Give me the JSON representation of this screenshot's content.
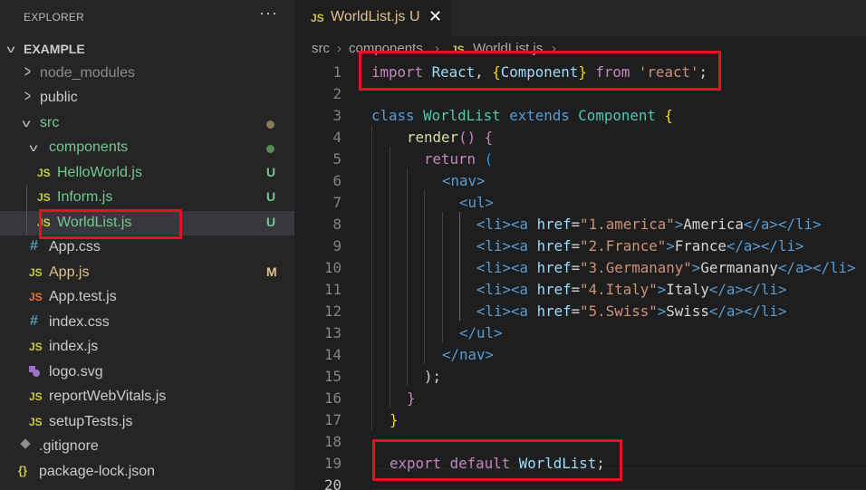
{
  "explorer": {
    "title": "EXPLORER",
    "more": "···",
    "section": "EXAMPLE",
    "items": [
      {
        "label": "node_modules",
        "status": ""
      },
      {
        "label": "public",
        "status": ""
      },
      {
        "label": "src",
        "status": ""
      },
      {
        "label": "components",
        "status": ""
      },
      {
        "label": "HelloWorld.js",
        "status": "U"
      },
      {
        "label": "Inform.js",
        "status": "U"
      },
      {
        "label": "WorldList.js",
        "status": "U"
      },
      {
        "label": "App.css",
        "status": ""
      },
      {
        "label": "App.js",
        "status": "M"
      },
      {
        "label": "App.test.js",
        "status": ""
      },
      {
        "label": "index.css",
        "status": ""
      },
      {
        "label": "index.js",
        "status": ""
      },
      {
        "label": "logo.svg",
        "status": ""
      },
      {
        "label": "reportWebVitals.js",
        "status": ""
      },
      {
        "label": "setupTests.js",
        "status": ""
      },
      {
        "label": ".gitignore",
        "status": ""
      },
      {
        "label": "package-lock.json",
        "status": ""
      }
    ],
    "icons": {
      "js": "JS",
      "css": "#",
      "svg": "svg-icon",
      "git": "gitignore-icon",
      "json": "{}"
    }
  },
  "tab": {
    "icon": "JS",
    "label": "WorldList.js",
    "status": "U",
    "close": "✕"
  },
  "breadcrumb": {
    "src": "src",
    "sep": "›",
    "components": "components",
    "file_icon": "JS",
    "file": "WorldList.js"
  },
  "code": {
    "line_numbers": [
      "1",
      "2",
      "3",
      "4",
      "5",
      "6",
      "7",
      "8",
      "9",
      "10",
      "11",
      "12",
      "13",
      "14",
      "15",
      "16",
      "17",
      "18",
      "19",
      "20"
    ],
    "l1": {
      "import": "import",
      "react": "React",
      "comma": ", ",
      "lb": "{",
      "component": "Component",
      "rb": "}",
      "from": "from",
      "module": "'react'",
      "semi": ";"
    },
    "l3": {
      "class": "class",
      "name": "WorldList",
      "extends": "extends",
      "base": "Component",
      "brace": "{"
    },
    "l4": {
      "render": "render",
      "paren": "()",
      "brace": "{"
    },
    "l5": {
      "return": "return",
      "paren": "("
    },
    "l6": "<nav>",
    "l7": "<ul>",
    "items": [
      {
        "href": "\"1.america\"",
        "text": "America"
      },
      {
        "href": "\"2.France\"",
        "text": "France"
      },
      {
        "href": "\"3.Germanany\"",
        "text": "Germanany"
      },
      {
        "href": "\"4.Italy\"",
        "text": "Italy"
      },
      {
        "href": "\"5.Swiss\"",
        "text": "Swiss"
      }
    ],
    "li_open": "<li>",
    "a_open": "<a",
    "href_attr": "href",
    "eq": "=",
    "gt": ">",
    "a_close": "</a>",
    "li_close": "</li>",
    "l13": "</ul>",
    "l14": "</nav>",
    "l15": ");",
    "l16": "}",
    "l17": "}",
    "l19": {
      "export": "export",
      "default": "default",
      "name": "WorldList",
      "semi": ";"
    }
  }
}
